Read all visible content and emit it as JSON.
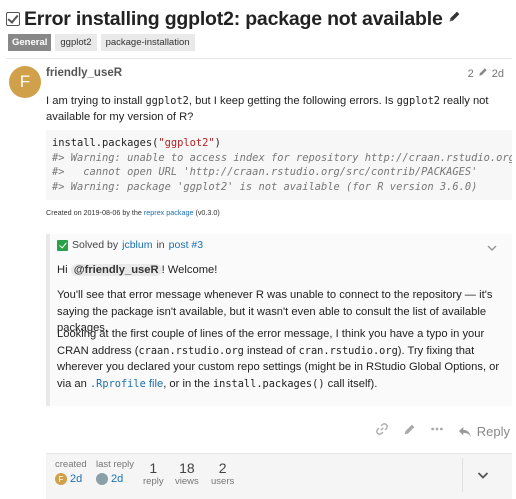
{
  "topic": {
    "title": "Error installing ggplot2: package not available",
    "category": "General",
    "tags": [
      "ggplot2",
      "package-installation"
    ]
  },
  "post": {
    "username": "friendly_useR",
    "avatar_letter": "F",
    "edits": "2",
    "age": "2d",
    "text_prefix": "I am trying to install ",
    "text_code1": "ggplot2",
    "text_mid": ", but I keep getting the following errors. Is ",
    "text_code2": "ggplot2",
    "text_suffix": " really not available for my version of R?",
    "code": {
      "line1_fn": "install.packages(",
      "line1_str": "\"ggplot2\"",
      "line1_end": ")",
      "line2": "#> Warning: unable to access index for repository http://craan.rstudio.org/s",
      "line3": "#>   cannot open URL 'http://craan.rstudio.org/src/contrib/PACKAGES'",
      "line4": "#> Warning: package 'ggplot2' is not available (for R version 3.6.0)"
    },
    "created_prefix": "Created on 2019-08-06 by the ",
    "created_link": "reprex package",
    "created_suffix": " (v0.3.0)"
  },
  "solution": {
    "solved_by": "Solved by",
    "solver": "jcblum",
    "in": "in",
    "post_link": "post #3",
    "greeting_hi": "Hi",
    "mention": "@friendly_useR",
    "greeting_rest": "! Welcome!",
    "para1": "You'll see that error message whenever R was unable to connect to the repository — it's saying the package isn't available, but it wasn't even able to consult the list of available packages.",
    "para2_a": "Looking at the first couple of lines of the error message, I think you have a typo in your CRAN address (",
    "para2_code1": "craan.rstudio.org",
    "para2_b": " instead of ",
    "para2_code2": "cran.rstudio.org",
    "para2_c": "). Try fixing that wherever you declared your custom repo settings (might be in RStudio Global Options, or via an ",
    "para2_code3": ".Rprofile",
    "para2_link": " file",
    "para2_d": ", or in the ",
    "para2_code4": "install.packages()",
    "para2_e": " call itself)."
  },
  "actions": {
    "reply_label": "Reply"
  },
  "topic_map": {
    "created_label": "created",
    "created_value": "2d",
    "last_reply_label": "last reply",
    "last_reply_value": "2d",
    "reply_count": "1",
    "reply_label": "reply",
    "views_count": "18",
    "views_label": "views",
    "users_count": "2",
    "users_label": "users"
  }
}
